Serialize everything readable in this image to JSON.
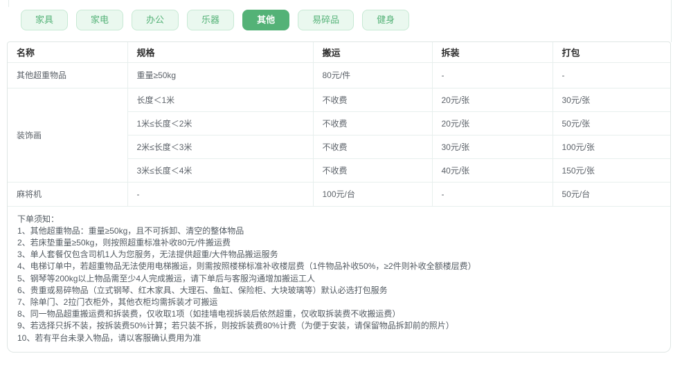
{
  "colors": {
    "accent_green": "#54b277",
    "tab_inactive_bg": "#eaf8ef",
    "tab_inactive_border": "#c7e9d4",
    "table_line": "#e7efed",
    "card_border": "#dfe6e4"
  },
  "tabs": {
    "items": [
      {
        "label": "家具",
        "active": false
      },
      {
        "label": "家电",
        "active": false
      },
      {
        "label": "办公",
        "active": false
      },
      {
        "label": "乐器",
        "active": false
      },
      {
        "label": "其他",
        "active": true
      },
      {
        "label": "易碎品",
        "active": false
      },
      {
        "label": "健身",
        "active": false
      }
    ]
  },
  "table": {
    "headers": [
      "名称",
      "规格",
      "搬运",
      "拆装",
      "打包"
    ],
    "rows": [
      {
        "name": "其他超重物品",
        "spec": "重量≥50kg",
        "move": "80元/件",
        "disassembly": "-",
        "pack": "-"
      },
      {
        "name": "装饰画",
        "spec": "长度＜1米",
        "move": "不收费",
        "disassembly": "20元/张",
        "pack": "30元/张"
      },
      {
        "spec": "1米≤长度＜2米",
        "move": "不收费",
        "disassembly": "20元/张",
        "pack": "50元/张"
      },
      {
        "spec": "2米≤长度＜3米",
        "move": "不收费",
        "disassembly": "30元/张",
        "pack": "100元/张"
      },
      {
        "spec": "3米≤长度＜4米",
        "move": "不收费",
        "disassembly": "40元/张",
        "pack": "150元/张"
      },
      {
        "name": "麻将机",
        "spec": "-",
        "move": "100元/台",
        "disassembly": "-",
        "pack": "50元/台"
      }
    ]
  },
  "notes": {
    "title": "下单须知：",
    "items": [
      "1、其他超重物品：重量≥50kg，且不可拆卸、清空的整体物品",
      "2、若床垫重量≥50kg，则按照超重标准补收80元/件搬运费",
      "3、单人套餐仅包含司机1人为您服务，无法提供超重/大件物品搬运服务",
      "4、电梯订单中，若超重物品无法使用电梯搬运，则需按照楼梯标准补收楼层费（1件物品补收50%，≥2件则补收全额楼层费）",
      "5、钢琴等200kg以上物品需至少4人完成搬运，请下单后与客服沟通增加搬运工人",
      "6、贵重或易碎物品（立式钢琴、红木家具、大理石、鱼缸、保险柜、大块玻璃等）默认必选打包服务",
      "7、除单门、2拉门衣柜外，其他衣柜均需拆装才可搬运",
      "8、同一物品超重搬运费和拆装费，仅收取1项（如挂墙电视拆装后依然超重，仅收取拆装费不收搬运费）",
      "9、若选择只拆不装，按拆装费50%计算；若只装不拆，则按拆装费80%计费（为便于安装，请保留物品拆卸前的照片）",
      "10、若有平台未录入物品，请以客服确认费用为准"
    ]
  }
}
